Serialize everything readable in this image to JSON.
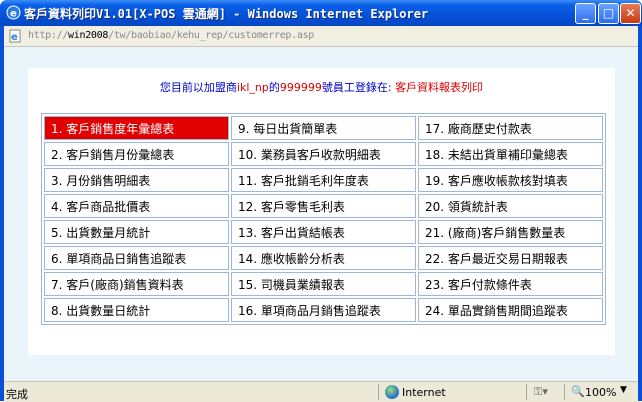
{
  "window": {
    "title": "客戶資料列印V1.01[X-POS 雲通網] - Windows Internet Explorer",
    "minimize": "_",
    "maximize": "□",
    "close": "✕"
  },
  "address": {
    "prefix": "http://",
    "host": "win2008",
    "path": "/tw/baobiao/kehu_rep/customerrep.asp"
  },
  "notice": {
    "part1": "您目前以加盟商",
    "company": "ikl_np",
    "part2": "的",
    "employee": "999999",
    "part3": "號員工登錄在: ",
    "page": "客戶資料報表列印"
  },
  "menu": [
    [
      "1. 客戶銷售度年彙總表",
      "9.  每日出貨簡單表",
      "17. 廠商歷史付款表"
    ],
    [
      "2. 客戶銷售月份彙總表",
      "10.  業務員客戶收款明細表",
      "18. 未結出貨單補印彙總表"
    ],
    [
      "3. 月份銷售明細表",
      "11.  客戶批銷毛利年度表",
      "19. 客戶應收帳款核對填表"
    ],
    [
      "4. 客戶商品批價表",
      "12.  客戶零售毛利表",
      "20. 領貨統計表"
    ],
    [
      "5. 出貨數量月統計",
      "13. 客戶出貨結帳表",
      "21. (廠商)客戶銷售數量表"
    ],
    [
      "6. 單項商品日銷售追蹤表",
      "14. 應收帳齡分析表",
      "22. 客戶最近交易日期報表"
    ],
    [
      "7.  客戶(廠商)銷售資料表",
      "15. 司機員業績報表",
      "23. 客戶付款條件表"
    ],
    [
      "8.  出貨數量日統計",
      "16. 單項商品月銷售追蹤表",
      "24. 單品實銷售期間追蹤表"
    ]
  ],
  "statusbar": {
    "status": "完成",
    "zone": "Internet",
    "zoom": "100%"
  },
  "colors": {
    "titlebar": "#0552d9",
    "active_item": "#e00000",
    "content_bg": "#eaf4fb",
    "border": "#9cb7dc"
  },
  "icons": [
    "ie-icon",
    "page-icon",
    "globe-icon",
    "lock-icon",
    "zoom-icon"
  ]
}
